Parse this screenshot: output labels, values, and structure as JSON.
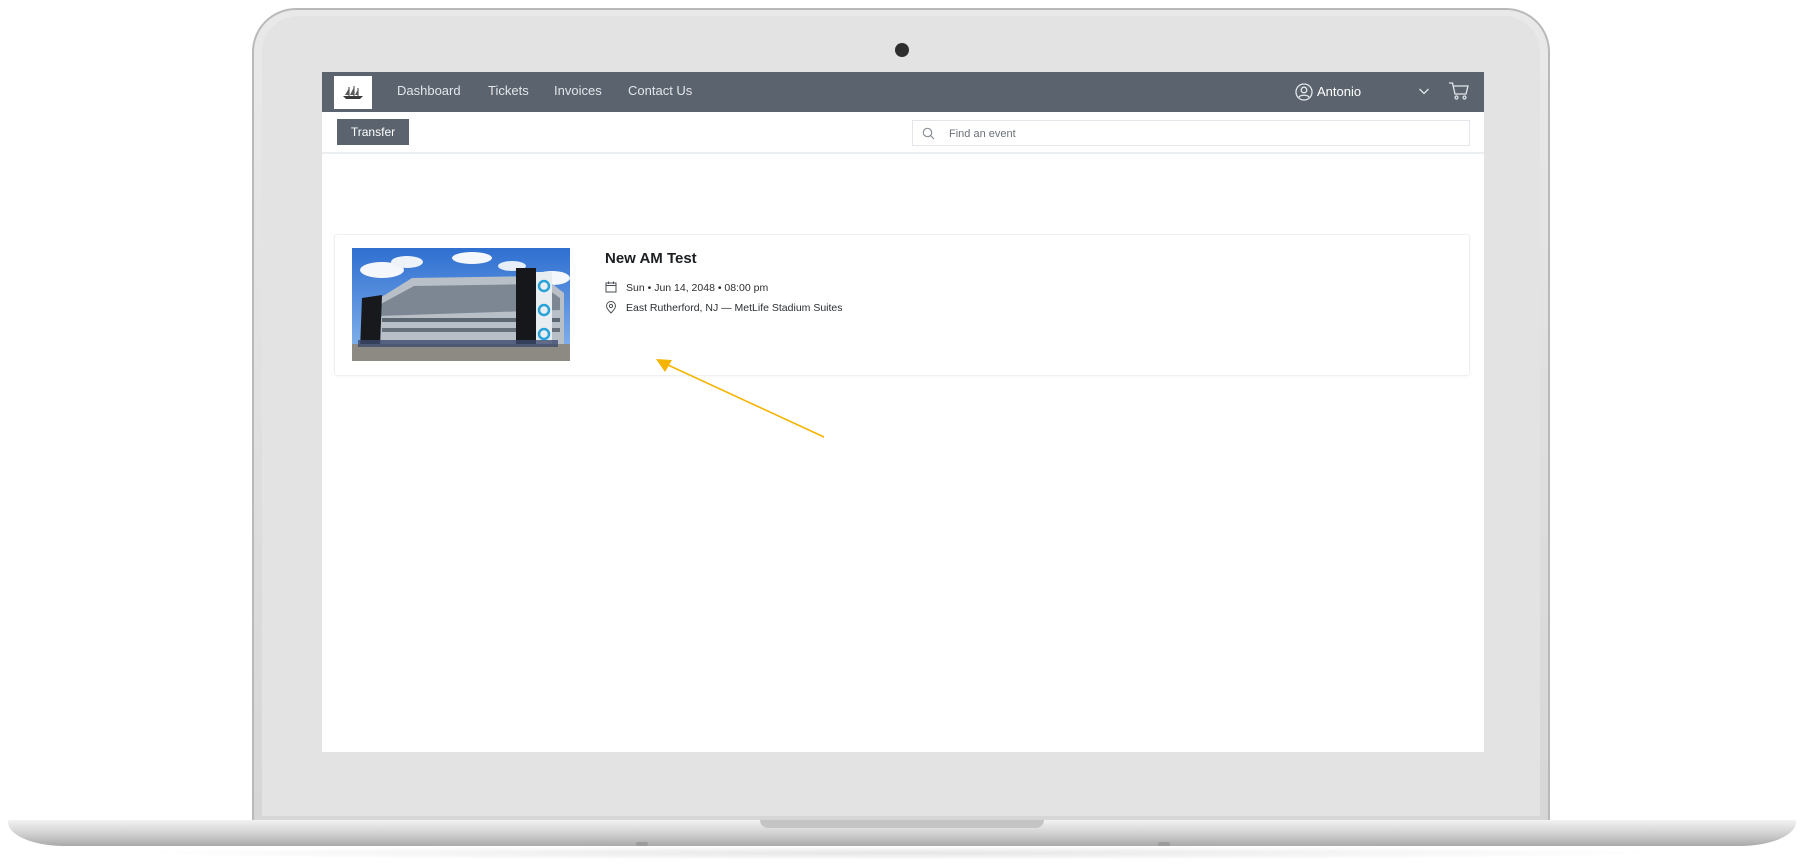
{
  "nav": {
    "links": [
      "Dashboard",
      "Tickets",
      "Invoices",
      "Contact Us"
    ],
    "user_name": "Antonio"
  },
  "toolbar": {
    "transfer_label": "Transfer",
    "search_placeholder": "Find an event"
  },
  "event": {
    "title": "New AM Test",
    "datetime": "Sun • Jun 14, 2048 • 08:00 pm",
    "location": "East Rutherford, NJ — MetLife Stadium Suites"
  },
  "colors": {
    "navbar": "#5b646e",
    "annotation_arrow": "#f5b400"
  }
}
